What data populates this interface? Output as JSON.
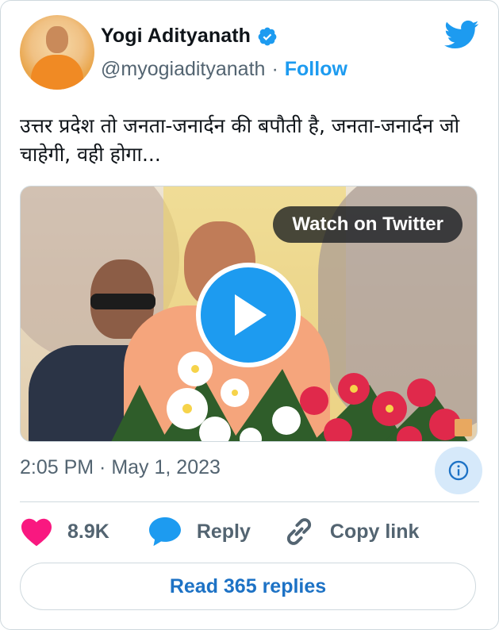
{
  "author": {
    "name": "Yogi Adityanath",
    "handle": "@myogiadityanath",
    "separator": "·",
    "follow_label": "Follow"
  },
  "tweet": {
    "text": "उत्तर प्रदेश तो जनता-जनार्दन की बपौती है, जनता-जनार्दन जो चाहेगी, वही होगा..."
  },
  "media": {
    "watch_label": "Watch on Twitter"
  },
  "meta": {
    "timestamp": "2:05 PM · May 1, 2023"
  },
  "actions": {
    "like_count": "8.9K",
    "reply_label": "Reply",
    "copy_label": "Copy link"
  },
  "footer": {
    "read_replies_label": "Read 365 replies"
  },
  "colors": {
    "accent": "#1d9bf0",
    "like": "#f91880",
    "muted": "#536471"
  },
  "icons": [
    "verified-badge-icon",
    "twitter-bird-icon",
    "play-icon",
    "info-icon",
    "heart-icon",
    "reply-bubble-icon",
    "link-icon"
  ]
}
